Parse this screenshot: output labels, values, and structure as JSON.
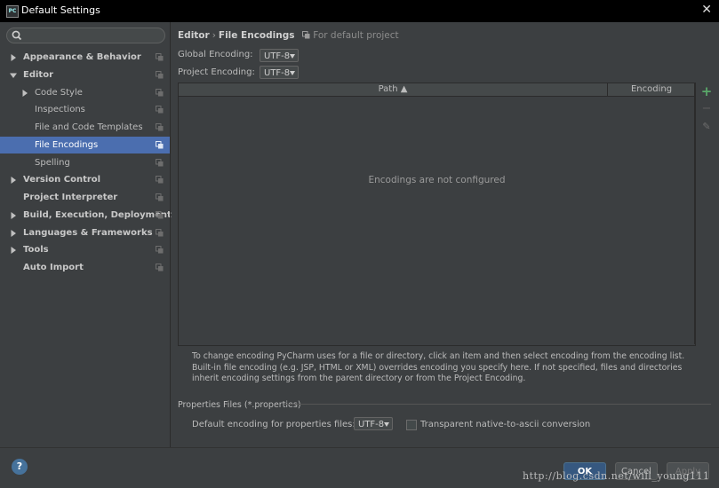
{
  "window": {
    "title": "Default Settings",
    "app_icon_text": "PC"
  },
  "search": {
    "placeholder": ""
  },
  "sidebar": {
    "items": [
      {
        "label": "Appearance & Behavior",
        "bold": true,
        "arrow": "right"
      },
      {
        "label": "Editor",
        "bold": true,
        "arrow": "down"
      },
      {
        "label": "Code Style",
        "bold": false,
        "arrow": "right"
      },
      {
        "label": "Inspections",
        "bold": false,
        "arrow": ""
      },
      {
        "label": "File and Code Templates",
        "bold": false,
        "arrow": ""
      },
      {
        "label": "File Encodings",
        "bold": false,
        "arrow": "",
        "selected": true
      },
      {
        "label": "Spelling",
        "bold": false,
        "arrow": ""
      },
      {
        "label": "Version Control",
        "bold": true,
        "arrow": "right"
      },
      {
        "label": "Project Interpreter",
        "bold": true,
        "arrow": ""
      },
      {
        "label": "Build, Execution, Deployment",
        "bold": true,
        "arrow": "right"
      },
      {
        "label": "Languages & Frameworks",
        "bold": true,
        "arrow": "right"
      },
      {
        "label": "Tools",
        "bold": true,
        "arrow": "right"
      },
      {
        "label": "Auto Import",
        "bold": true,
        "arrow": ""
      }
    ]
  },
  "breadcrumb": {
    "parent": "Editor",
    "separator": "›",
    "current": "File Encodings",
    "scope": "For default project"
  },
  "settings": {
    "global_label": "Global Encoding:",
    "global_value": "UTF-8",
    "project_label": "Project Encoding:",
    "project_value": "UTF-8"
  },
  "table": {
    "columns": [
      "Path ▲",
      "Encoding"
    ],
    "empty_text": "Encodings are not configured"
  },
  "toolbar": {
    "add": "+",
    "remove": "−",
    "edit": "✎"
  },
  "info_text": "To change encoding PyCharm uses for a file or directory, click an item and then select encoding from the encoding list. Built-in file encoding (e.g. JSP, HTML or XML) overrides encoding you specify here. If not specified, files and directories inherit encoding settings from the parent directory or from the Project Encoding.",
  "properties": {
    "section_title": "Properties Files (*.properties)",
    "default_label": "Default encoding for properties files:",
    "default_value": "UTF-8",
    "checkbox_label": "Transparent native-to-ascii conversion",
    "checkbox_checked": false
  },
  "buttons": {
    "help": "?",
    "ok": "OK",
    "cancel": "Cancel",
    "apply": "Apply"
  },
  "watermark": "http://blog.csdn.net/will_young111",
  "colors": {
    "selection": "#4b6eaf",
    "add_icon": "#59a869",
    "ok_button": "#365880"
  }
}
